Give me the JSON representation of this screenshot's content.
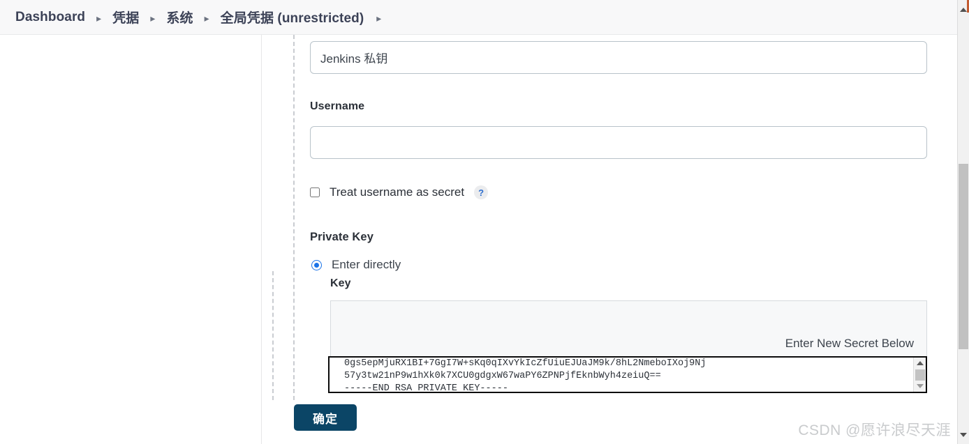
{
  "breadcrumb": {
    "items": [
      {
        "label": "Dashboard"
      },
      {
        "label": "凭据"
      },
      {
        "label": "系统"
      },
      {
        "label": "全局凭据 (unrestricted)"
      }
    ],
    "separator": "▸"
  },
  "form": {
    "description_value": "Jenkins 私钥",
    "username_label": "Username",
    "username_value": "",
    "username_placeholder": "",
    "treat_username_as_secret_label": "Treat username as secret",
    "help_icon_glyph": "?",
    "private_key_label": "Private Key",
    "enter_directly_label": "Enter directly",
    "key_label": "Key",
    "secret_panel_text": "Enter New Secret Below",
    "secret_value": "0gs5epMjuRX1BI+7GgI7W+sKq0qIXvYkIcZfUiuEJUaJM9k/8hL2NmeboIXoj9Nj\n57y3tw21nP9w1hXk0k7XCU0gdgxW67waPY6ZPNPjfEknbWyh4zeiuQ==\n-----END RSA PRIVATE KEY-----",
    "submit_label": "确定"
  },
  "watermark": {
    "text": "CSDN @愿许浪尽天涯"
  },
  "colors": {
    "submit_button": "#0b4566",
    "radio_accent": "#1a73e8",
    "help_icon_text": "#2f6fd0",
    "breadcrumb_bg": "#f8f8f9",
    "secret_panel_bg": "#f7f8f9"
  }
}
